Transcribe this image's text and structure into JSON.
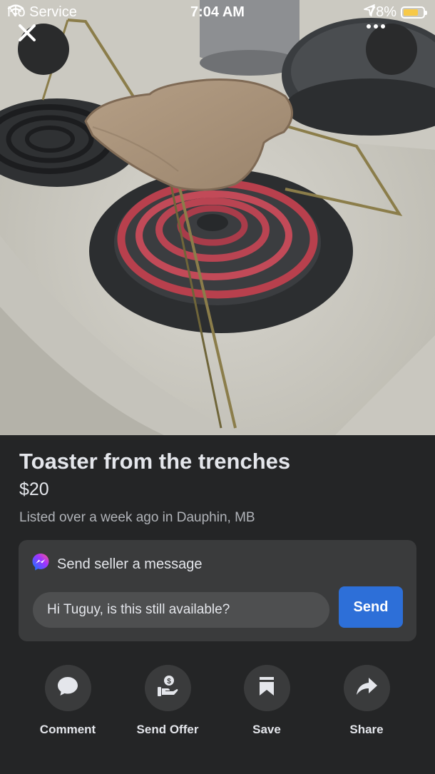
{
  "status_bar": {
    "carrier": "No Service",
    "time": "7:04 AM",
    "battery": "78%",
    "battery_level": 0.78,
    "icons": [
      "wifi-icon",
      "location-arrow-icon",
      "battery-icon"
    ]
  },
  "photo": {
    "description_icon": "listing-photo"
  },
  "overlay": {
    "close_icon": "close-icon",
    "more_icon": "more-dots-icon"
  },
  "listing": {
    "title": "Toaster from the trenches",
    "price": "$20",
    "meta": "Listed over a week ago in Dauphin, MB"
  },
  "message": {
    "header": "Send seller a message",
    "input_value": "Hi Tuguy, is this still available?",
    "send_label": "Send"
  },
  "actions": [
    {
      "label": "Comment",
      "icon": "comment-icon"
    },
    {
      "label": "Send Offer",
      "icon": "send-offer-icon"
    },
    {
      "label": "Save",
      "icon": "bookmark-icon"
    },
    {
      "label": "Share",
      "icon": "share-icon"
    }
  ],
  "colors": {
    "background": "#242526",
    "card": "#3a3b3c",
    "accent": "#2d6fd8",
    "battery": "#f7c948"
  }
}
